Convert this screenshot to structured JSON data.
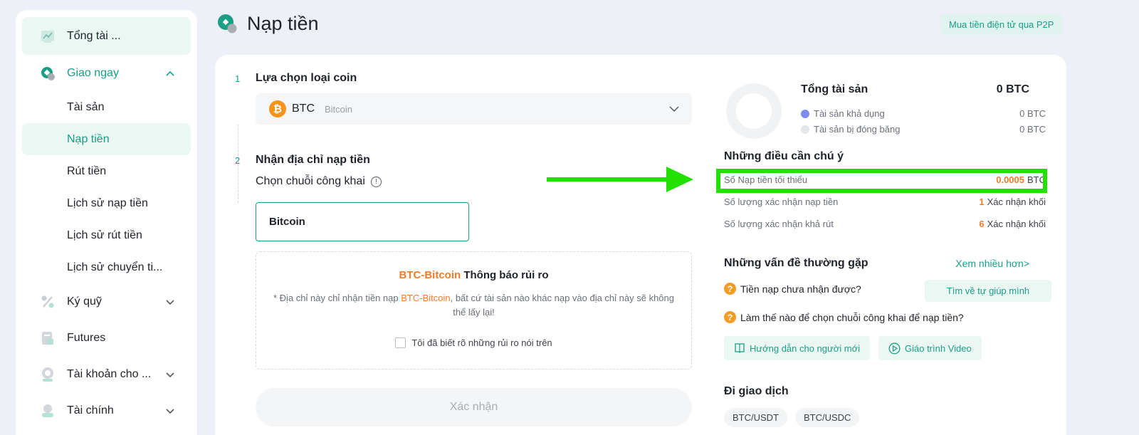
{
  "sidebar": {
    "items": [
      {
        "label": "Tổng tài ...",
        "icon": "chart-icon"
      },
      {
        "label": "Giao ngay",
        "icon": "spot-icon"
      },
      {
        "label": "Ký quỹ",
        "icon": "percent-icon"
      },
      {
        "label": "Futures",
        "icon": "document-icon"
      },
      {
        "label": "Tài khoản cho ...",
        "icon": "user-icon"
      },
      {
        "label": "Tài chính",
        "icon": "finance-icon"
      }
    ],
    "sub_items": [
      "Tài sản",
      "Nạp tiền",
      "Rút tiền",
      "Lịch sử nạp tiền",
      "Lịch sử rút tiền",
      "Lịch sử chuyển ti..."
    ]
  },
  "header": {
    "title": "Nạp tiền",
    "p2p_button": "Mua tiền điện tử qua P2P"
  },
  "step1": {
    "number": "1",
    "title": "Lựa chọn loại coin",
    "coin_symbol": "BTC",
    "coin_name": "Bitcoin",
    "coin_logo": "₿"
  },
  "step2": {
    "number": "2",
    "title": "Nhận địa chỉ nạp tiền",
    "chain_label": "Chọn chuỗi công khai",
    "chain_option": "Bitcoin",
    "risk_coin": "BTC-Bitcoin",
    "risk_title": "Thông báo rủi ro",
    "risk_desc_prefix": "* Địa chỉ này chỉ nhận tiền nạp ",
    "risk_desc_coin": "BTC-Bitcoin",
    "risk_desc_suffix": ", bất cứ tài sản nào khác nạp vào địa chỉ này sẽ không thể lấy lại!",
    "risk_checkbox": "Tôi đã biết rõ những rủi ro nói trên",
    "confirm": "Xác nhận"
  },
  "assets": {
    "title": "Tổng tài sản",
    "total": "0 BTC",
    "available_label": "Tài sản khả dụng",
    "available_value": "0 BTC",
    "available_color": "#7b8cf0",
    "frozen_label": "Tài sản bị đóng băng",
    "frozen_value": "0 BTC",
    "frozen_color": "#e4e6ea"
  },
  "notes": {
    "title": "Những điều cần chú ý",
    "min_label": "Số Nạp tiền tối thiểu",
    "min_value": "0.0005",
    "min_unit": "BTC",
    "confirm_label": "Số lượng xác nhận nạp tiền",
    "confirm_value": "1",
    "confirm_unit": "Xác nhận khối",
    "withdraw_label": "Số lượng xác nhận khả rút",
    "withdraw_value": "6",
    "withdraw_unit": "Xác nhận khối",
    "highlight_color": "#22e100"
  },
  "faq": {
    "title": "Những vấn đề thường gặp",
    "see_more": "Xem nhiều hơn>",
    "q1": "Tiền nạp chưa nhận được?",
    "q1_button": "Tìm về tự giúp mình",
    "q2": "Làm thế nào để chọn chuỗi công khai để nạp tiền?",
    "guide_button": "Hướng dẫn cho người mới",
    "video_button": "Giáo trình Video",
    "q_icon": "?"
  },
  "trade": {
    "title": "Đi giao dịch",
    "pairs": [
      "BTC/USDT",
      "BTC/USDC"
    ]
  },
  "colors": {
    "accent": "#1a9e86",
    "orange": "#f07c2a"
  }
}
